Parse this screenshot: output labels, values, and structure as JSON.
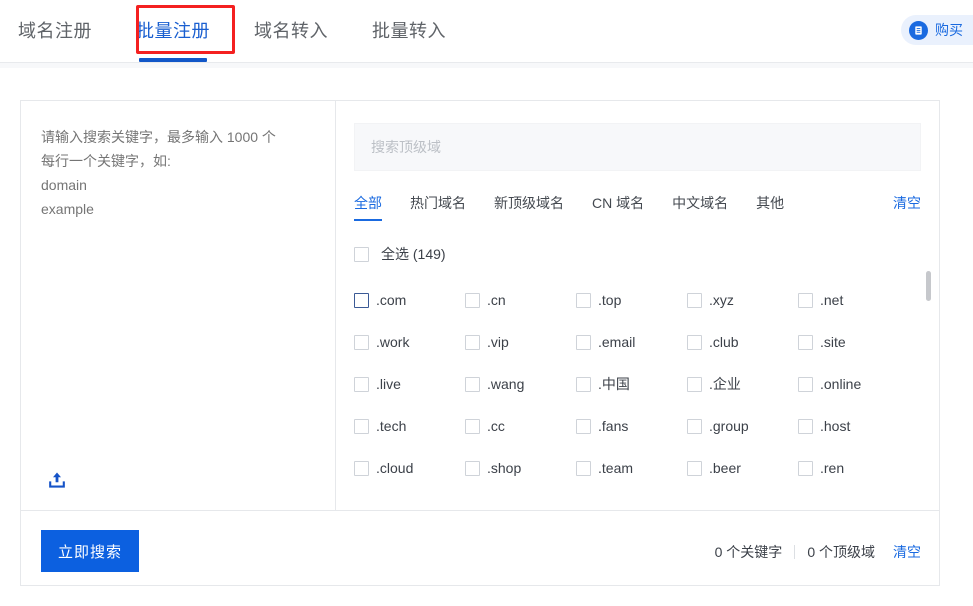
{
  "header": {
    "tabs": [
      {
        "label": "域名注册",
        "active": false
      },
      {
        "label": "批量注册",
        "active": true
      },
      {
        "label": "域名转入",
        "active": false
      },
      {
        "label": "批量转入",
        "active": false
      }
    ],
    "purchase": {
      "label": "购买",
      "icon": "document-icon"
    }
  },
  "keyword_panel": {
    "placeholder": "请输入搜索关键字，最多输入 1000 个\n每行一个关键字，如:\ndomain\nexample",
    "value": "",
    "upload_icon": "upload-icon"
  },
  "tld_panel": {
    "search": {
      "placeholder": "搜索顶级域",
      "value": ""
    },
    "filter_tabs": [
      {
        "label": "全部",
        "active": true
      },
      {
        "label": "热门域名",
        "active": false
      },
      {
        "label": "新顶级域名",
        "active": false
      },
      {
        "label": "CN 域名",
        "active": false
      },
      {
        "label": "中文域名",
        "active": false
      },
      {
        "label": "其他",
        "active": false
      }
    ],
    "clear_label": "清空",
    "select_all": {
      "label": "全选 (149)",
      "checked": false
    },
    "tlds": [
      {
        "label": ".com",
        "checked": false,
        "focused": true
      },
      {
        "label": ".cn",
        "checked": false,
        "focused": false
      },
      {
        "label": ".top",
        "checked": false,
        "focused": false
      },
      {
        "label": ".xyz",
        "checked": false,
        "focused": false
      },
      {
        "label": ".net",
        "checked": false,
        "focused": false
      },
      {
        "label": ".work",
        "checked": false,
        "focused": false
      },
      {
        "label": ".vip",
        "checked": false,
        "focused": false
      },
      {
        "label": ".email",
        "checked": false,
        "focused": false
      },
      {
        "label": ".club",
        "checked": false,
        "focused": false
      },
      {
        "label": ".site",
        "checked": false,
        "focused": false
      },
      {
        "label": ".live",
        "checked": false,
        "focused": false
      },
      {
        "label": ".wang",
        "checked": false,
        "focused": false
      },
      {
        "label": ".中国",
        "checked": false,
        "focused": false
      },
      {
        "label": ".企业",
        "checked": false,
        "focused": false
      },
      {
        "label": ".online",
        "checked": false,
        "focused": false
      },
      {
        "label": ".tech",
        "checked": false,
        "focused": false
      },
      {
        "label": ".cc",
        "checked": false,
        "focused": false
      },
      {
        "label": ".fans",
        "checked": false,
        "focused": false
      },
      {
        "label": ".group",
        "checked": false,
        "focused": false
      },
      {
        "label": ".host",
        "checked": false,
        "focused": false
      },
      {
        "label": ".cloud",
        "checked": false,
        "focused": false
      },
      {
        "label": ".shop",
        "checked": false,
        "focused": false
      },
      {
        "label": ".team",
        "checked": false,
        "focused": false
      },
      {
        "label": ".beer",
        "checked": false,
        "focused": false
      },
      {
        "label": ".ren",
        "checked": false,
        "focused": false
      }
    ]
  },
  "footer": {
    "search_button": "立即搜索",
    "keyword_count": "0 个关键字",
    "tld_count": "0 个顶级域",
    "clear_label": "清空"
  },
  "colors": {
    "accent_blue": "#1a6ae0",
    "button_blue": "#0c60e0",
    "tab_underline": "#1257c8",
    "highlight_red": "#f42020",
    "panel_bg": "#f7f8fa",
    "border": "#e6e8eb"
  }
}
